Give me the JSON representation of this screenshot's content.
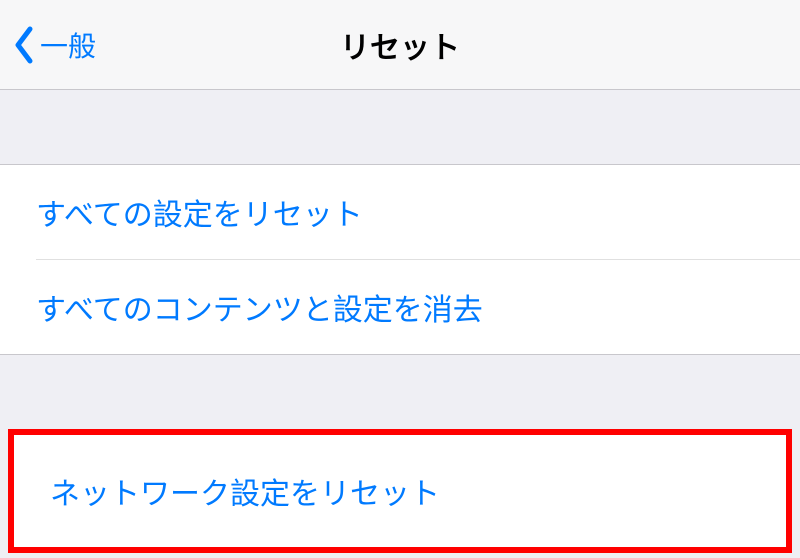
{
  "nav": {
    "back_label": "一般",
    "title": "リセット"
  },
  "group1": {
    "item1_label": "すべての設定をリセット",
    "item2_label": "すべてのコンテンツと設定を消去"
  },
  "group2": {
    "item1_label": "ネットワーク設定をリセット"
  },
  "colors": {
    "accent": "#007aff",
    "highlight_border": "#ff0000",
    "background": "#efeff4"
  }
}
